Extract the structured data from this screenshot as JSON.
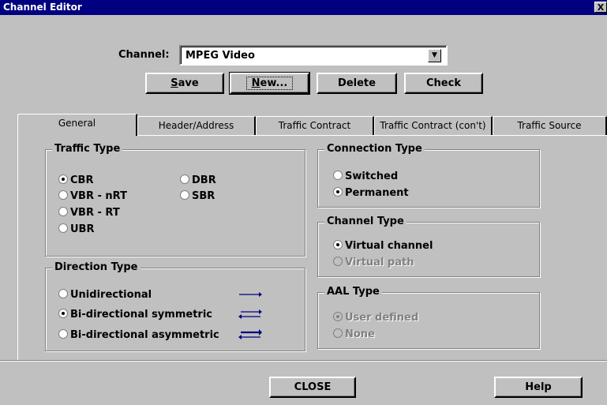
{
  "window": {
    "title": "Channel Editor",
    "close_glyph": "X"
  },
  "channel": {
    "label": "Channel:",
    "value": "MPEG Video"
  },
  "buttons": {
    "save_rest": "ave",
    "save_u": "S",
    "new_u": "N",
    "new_rest": "ew...",
    "delete": "Delete",
    "check": "Check",
    "close": "CLOSE",
    "help": "Help"
  },
  "tabs": [
    "General",
    "Header/Address",
    "Traffic Contract",
    "Traffic Contract (con't)",
    "Traffic Source"
  ],
  "traffic_type": {
    "legend": "Traffic Type",
    "options": [
      "CBR",
      "DBR",
      "VBR - nRT",
      "SBR",
      "VBR - RT",
      "UBR"
    ],
    "selected": "CBR"
  },
  "direction_type": {
    "legend": "Direction Type",
    "options": [
      "Unidirectional",
      "Bi-directional symmetric",
      "Bi-directional asymmetric"
    ],
    "selected": "Bi-directional symmetric"
  },
  "connection_type": {
    "legend": "Connection Type",
    "options": [
      "Switched",
      "Permanent"
    ],
    "selected": "Permanent"
  },
  "channel_type": {
    "legend": "Channel Type",
    "options": [
      "Virtual channel",
      "Virtual path"
    ],
    "selected": "Virtual channel"
  },
  "aal_type": {
    "legend": "AAL Type",
    "options": [
      "User defined",
      "None"
    ],
    "selected": "User defined"
  },
  "colors": {
    "titlebar": "#000080",
    "arrow": "#000080",
    "face": "#c0c0c0"
  }
}
